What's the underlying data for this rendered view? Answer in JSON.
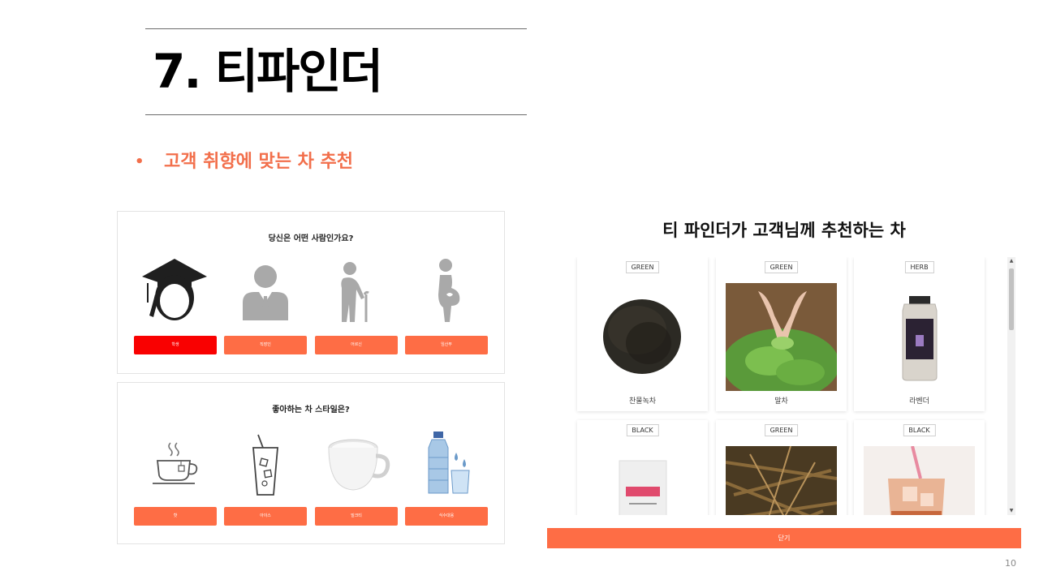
{
  "slide": {
    "title": "7. 티파인더",
    "bullet_dot": "•",
    "bullet_text": "고객 취향에 맞는 차 추천",
    "page_number": "10",
    "accent_color": "#f26f4b"
  },
  "survey": {
    "q1": {
      "question": "당신은 어떤 사람인가요?",
      "options": [
        {
          "label": "학생",
          "icon": "graduate-icon",
          "selected": true
        },
        {
          "label": "직장인",
          "icon": "office-worker-icon",
          "selected": false
        },
        {
          "label": "어르신",
          "icon": "elderly-icon",
          "selected": false
        },
        {
          "label": "임산부",
          "icon": "pregnant-woman-icon",
          "selected": false
        }
      ]
    },
    "q2": {
      "question": "좋아하는 차 스타일은?",
      "options": [
        {
          "label": "핫",
          "icon": "hot-tea-cup-icon"
        },
        {
          "label": "아이스",
          "icon": "iced-drink-icon"
        },
        {
          "label": "밀크티",
          "icon": "milk-tea-icon"
        },
        {
          "label": "식수대용",
          "icon": "water-bottle-icon"
        }
      ]
    },
    "button_color": "#fe6d45",
    "selected_button_color": "#f90101"
  },
  "finder": {
    "title": "티 파인더가 고객님께 추천하는 차",
    "cards": [
      {
        "tag": "GREEN",
        "name": "찬물녹차",
        "image": "loose-leaf-tea-pile"
      },
      {
        "tag": "GREEN",
        "name": "말차",
        "image": "hands-holding-fresh-tea-leaves"
      },
      {
        "tag": "HERB",
        "name": "라벤더",
        "image": "lavender-tea-jar"
      },
      {
        "tag": "BLACK",
        "name": "",
        "image": "tea-pouch-package"
      },
      {
        "tag": "GREEN",
        "name": "",
        "image": "dried-tea-leaves"
      },
      {
        "tag": "BLACK",
        "name": "",
        "image": "iced-black-tea-glass"
      }
    ],
    "close_label": "닫기"
  }
}
